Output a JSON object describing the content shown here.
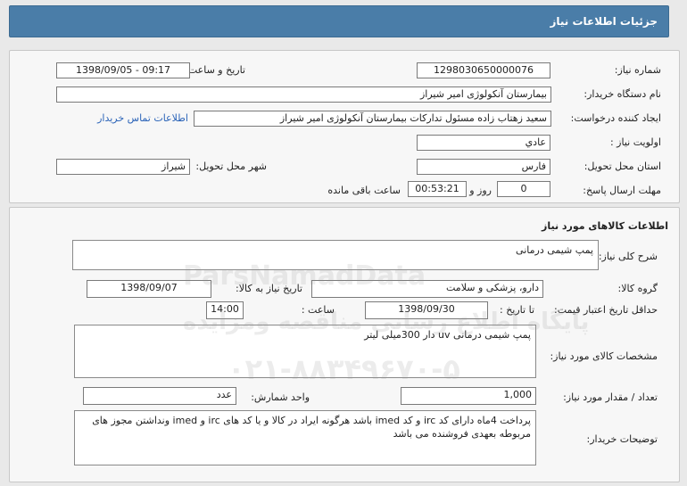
{
  "header": {
    "title": "جزئیات اطلاعات نیاز"
  },
  "need": {
    "number_label": "شماره نیاز:",
    "number": "1298030650000076",
    "announce_label": "تاریخ و ساعت اعلان عمومی:",
    "announce_value": "1398/09/05 - 09:17",
    "buyer_label": "نام دستگاه خریدار:",
    "buyer": "بیمارستان آنکولوژی امیر شیراز",
    "creator_label": "ایجاد کننده درخواست:",
    "creator": "سعید زهتاب زاده مسئول تداركات بيمارستان آنكولوژی امیر شیراز",
    "contact_link": "اطلاعات تماس خریدار",
    "priority_label": "اولویت نیاز :",
    "priority": "عادي",
    "province_label": "استان محل تحویل:",
    "province": "فارس",
    "city_label": "شهر محل تحویل:",
    "city": "شیراز",
    "deadline_label": "مهلت ارسال پاسخ:",
    "days": "0",
    "days_word": "روز و",
    "time_left": "00:53:21",
    "time_left_suffix": "ساعت باقی مانده"
  },
  "goods": {
    "section_title": "اطلاعات کالاهای مورد نیاز",
    "desc_label": "شرح کلی نیاز:",
    "desc": "پمپ شیمی درمانی",
    "group_label": "گروه کالا:",
    "group": "دارو، پزشکی و سلامت",
    "need_date_label": "تاریخ نیاز به کالا:",
    "need_date": "1398/09/07",
    "validity_label": "حداقل تاریخ اعتبار قیمت:",
    "until_label": "تا تاریخ :",
    "validity_date": "1398/09/30",
    "hour_label": "ساعت :",
    "validity_hour": "14:00",
    "spec_label": "مشخصات کالای مورد نیاز:",
    "spec": "پمپ شیمی درمانی uv دار 300میلی لیتر",
    "qty_label": "تعداد / مقدار مورد نیاز:",
    "qty": "1,000",
    "unit_label": "واحد شمارش:",
    "unit": "عدد",
    "notes_label": "توضیحات خریدار:",
    "notes": "پرداخت 4ماه دارای کد irc و کد imed  باشد هرگونه ایراد در کالا و یا کد های irc و imed ونداشتن مجوز های مربوطه بعهدی فروشنده می باشد"
  },
  "watermark": {
    "line1": "ParsNamadData",
    "line2": "پایگاه اطلاع رسانی مناقصه ومزایده",
    "line3": "۰۲۱-۸۸۳۴۹۶۷۰-۵"
  }
}
